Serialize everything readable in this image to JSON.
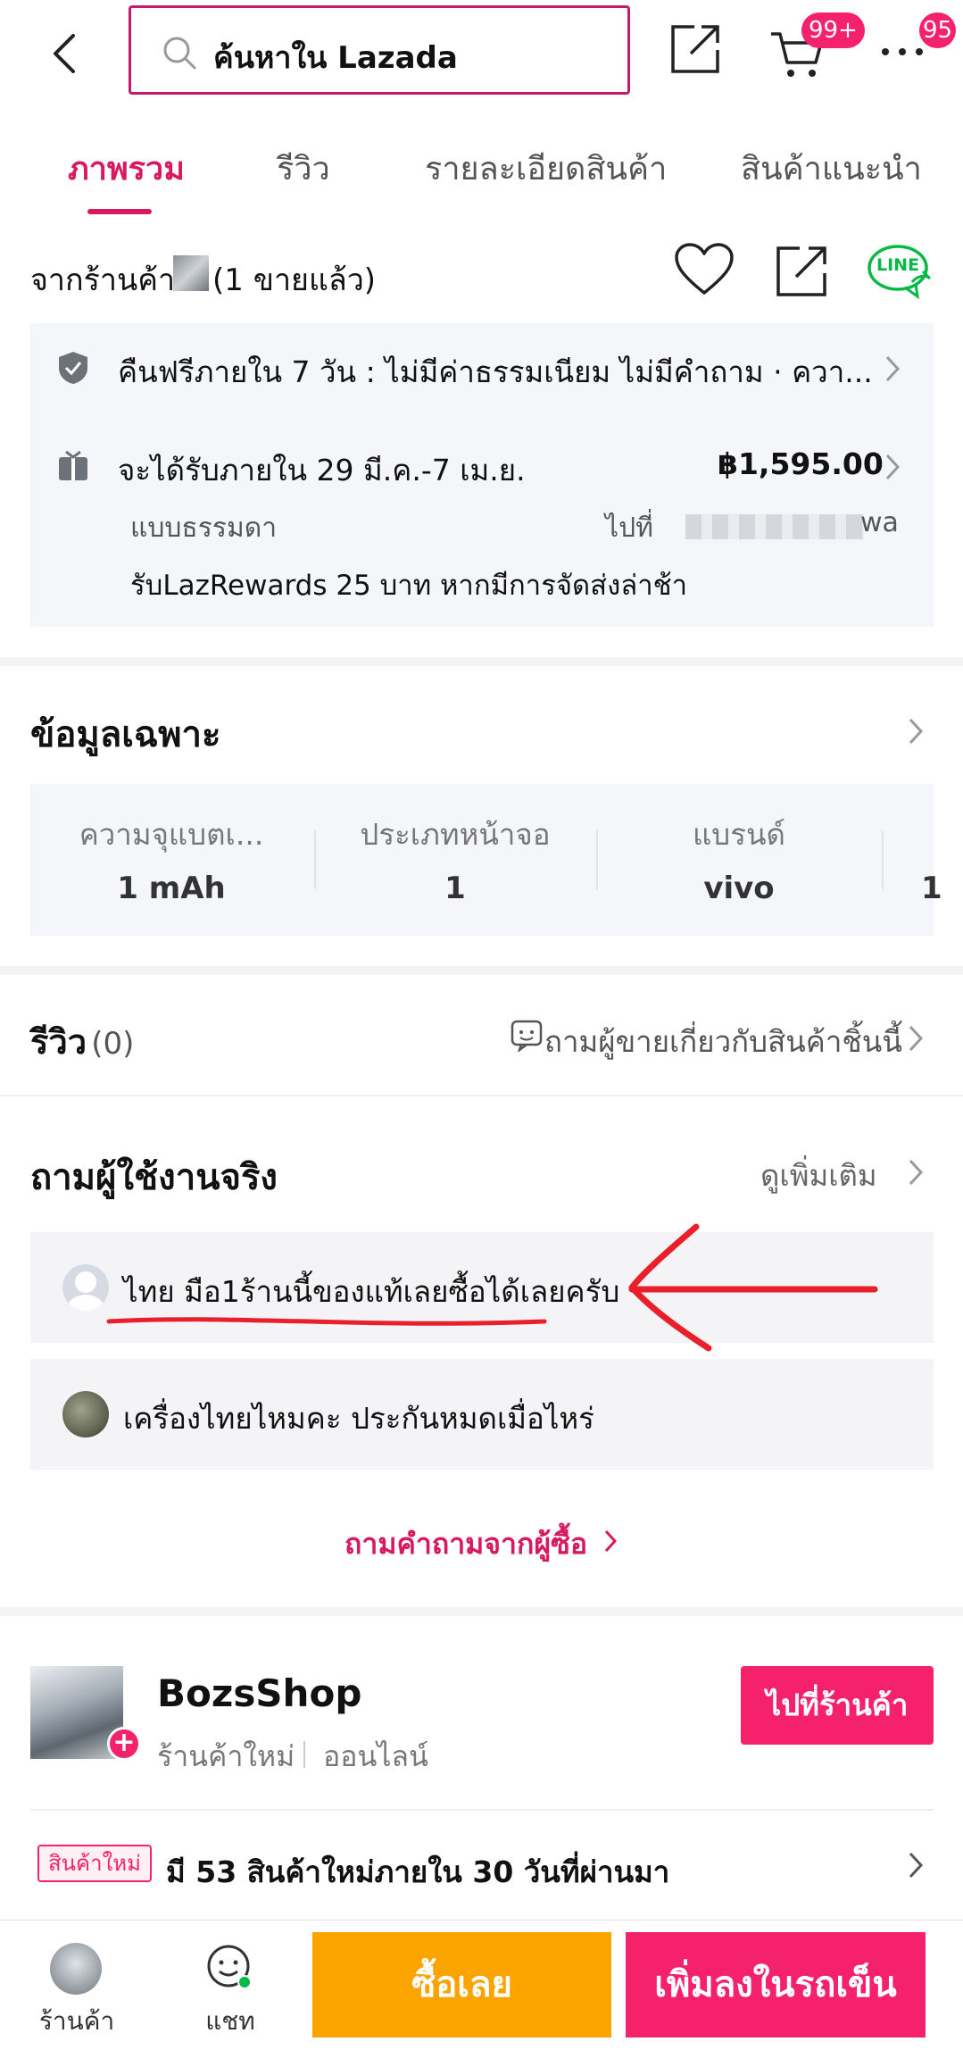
{
  "colors": {
    "brand_pink": "#f5226b",
    "tab_active": "#d7195f",
    "buy_orange": "#fba400",
    "line_green": "#06b844",
    "annotation_red": "#e8202c"
  },
  "header": {
    "search_placeholder": "ค้นหาใน Lazada",
    "cart_badge": "99+",
    "more_badge": "95",
    "icons": [
      "back-arrow-icon",
      "search-icon",
      "share-icon",
      "cart-icon",
      "more-icon"
    ]
  },
  "tabs": [
    {
      "label": "ภาพรวม",
      "active": true
    },
    {
      "label": "รีวิว",
      "active": false
    },
    {
      "label": "รายละเอียดสินค้า",
      "active": false
    },
    {
      "label": "สินค้าแนะนำ",
      "active": false
    }
  ],
  "seller_info": {
    "prefix": "จากร้านค้า",
    "sold": "(1 ขายแล้ว)",
    "line_label": "LINE"
  },
  "service": {
    "return_policy": "คืนฟรีภายใน 7 วัน : ไม่มีค่าธรรมเนียม ไม่มีคำถาม · ควา...",
    "delivery": "จะได้รับภายใน 29 มี.ค.-7 เม.ย.",
    "delivery_price": "฿1,595.00",
    "shipping_type": "แบบธรรมดา",
    "destination": "ไปที่ ",
    "destination_tail": "wa",
    "rewards": "รับLazRewards 25 บาท หากมีการจัดส่งล่าช้า"
  },
  "specs": {
    "title": "ข้อมูลเฉพาะ",
    "items": [
      {
        "label": "ความจุแบตเ...",
        "value": "1 mAh"
      },
      {
        "label": "ประเภทหน้าจอ",
        "value": "1"
      },
      {
        "label": "แบรนด์",
        "value": "vivo"
      },
      {
        "label": "",
        "value": "1"
      }
    ]
  },
  "reviews": {
    "title": "รีวิว",
    "count": "(0)",
    "ask_seller": "ถามผู้ขายเกี่ยวกับสินค้าชิ้นนี้"
  },
  "qa": {
    "title": "ถามผู้ใช้งานจริง",
    "see_more": "ดูเพิ่มเติม",
    "questions": [
      {
        "text": "ไทย มือ1ร้านนี้ของแท้เลยซื้อได้เลยครับ"
      },
      {
        "text": "เครื่องไทยไหมคะ ประกันหมดเมื่อไหร่"
      }
    ],
    "ask_buyers": "ถามคำถามจากผู้ซื้อ"
  },
  "shop": {
    "name": "BozsShop",
    "type": "ร้านค้าใหม่",
    "status": "ออนไลน์",
    "visit_button": "ไปที่ร้านค้า",
    "new_tag": "สินค้าใหม่",
    "new_products": "มี 53 สินค้าใหม่ภายใน 30 วันที่ผ่านมา"
  },
  "bottom": {
    "shop_label": "ร้านค้า",
    "chat_label": "แชท",
    "buy_now": "ซื้อเลย",
    "add_to_cart": "เพิ่มลงในรถเข็น"
  }
}
